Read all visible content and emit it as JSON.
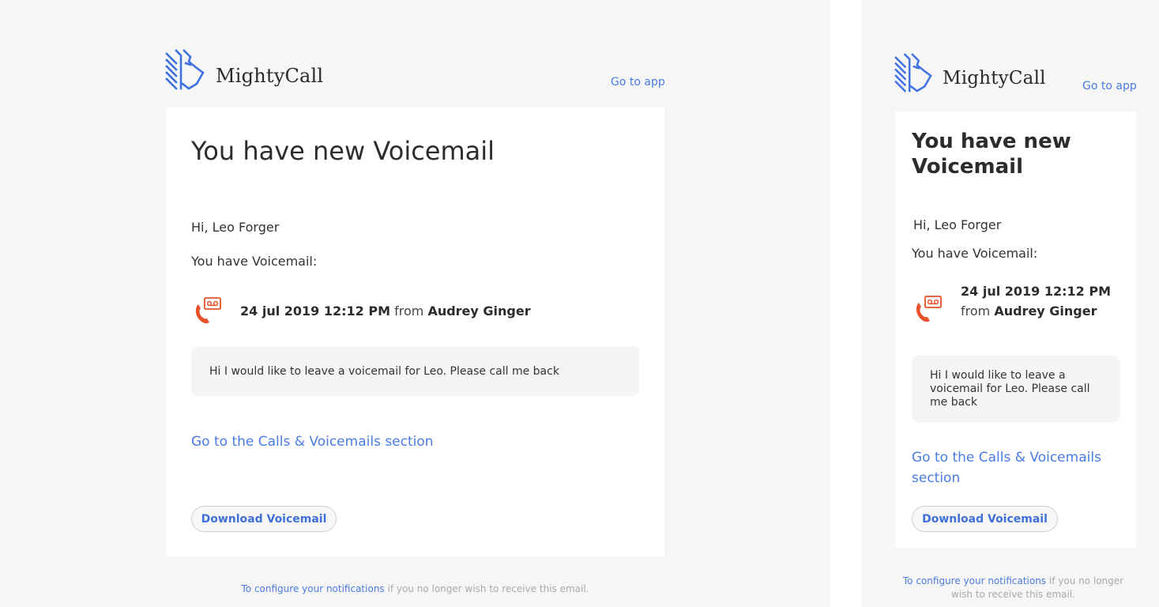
{
  "brand": {
    "name": "MightyCall",
    "logo_icon": "lion-head-logo-icon",
    "accent_color": "#4a7be0"
  },
  "header": {
    "go_to_app": "Go to app"
  },
  "email": {
    "title": "You have new Voicemail",
    "greeting": "Hi, Leo Forger",
    "intro": "You have Voicemail:",
    "voicemail": {
      "icon": "voicemail-phone-icon",
      "icon_color": "#e8512a",
      "datetime": "24 jul 2019 12:12 PM",
      "from_label": "from",
      "caller": "Audrey Ginger",
      "transcript": "Hi I would like to leave a voicemail for Leo. Please call me back"
    },
    "section_link": "Go to the Calls & Voicemails section",
    "download_button": "Download Voicemail"
  },
  "footer": {
    "link": "To configure your notifications",
    "text": " if you no longer wish to receive this email."
  },
  "views": [
    "desktop",
    "mobile"
  ]
}
